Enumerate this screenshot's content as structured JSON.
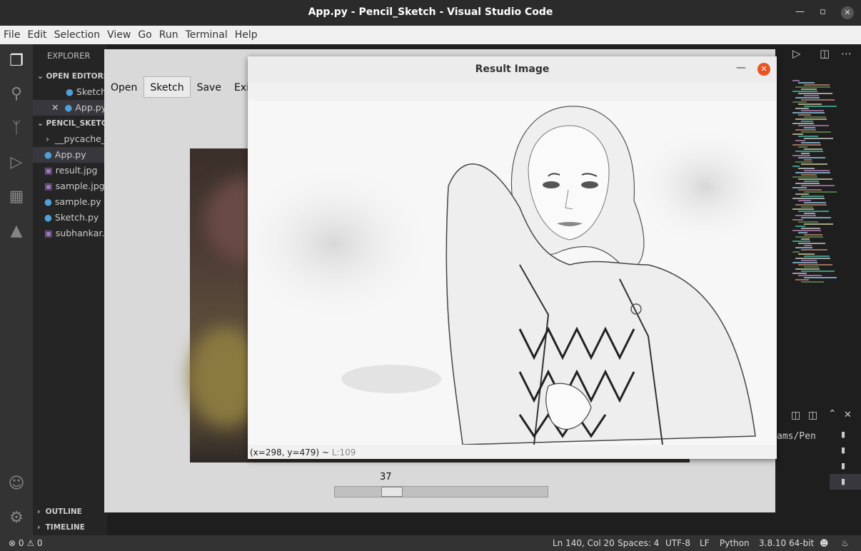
{
  "window": {
    "title": "App.py - Pencil_Sketch - Visual Studio Code"
  },
  "menubar": [
    "File",
    "Edit",
    "Selection",
    "View",
    "Go",
    "Run",
    "Terminal",
    "Help"
  ],
  "activity_icons": [
    "files-icon",
    "search-icon",
    "source-control-icon",
    "run-debug-icon",
    "extensions-icon",
    "testing-icon",
    "account-icon",
    "settings-gear-icon"
  ],
  "sidebar": {
    "header": "EXPLORER",
    "open_editors": "OPEN EDITORS",
    "open_files": [
      "Sketch.py",
      "App.py"
    ],
    "project": "PENCIL_SKETCH",
    "files": [
      "__pycache__",
      "App.py",
      "result.jpg",
      "sample.jpg",
      "sample.py",
      "Sketch.py",
      "subhankar.jpg"
    ],
    "outline": "OUTLINE",
    "timeline": "TIMELINE"
  },
  "terminal": {
    "text": "ams/Pen"
  },
  "app": {
    "buttons": [
      "Open",
      "Sketch",
      "Save",
      "Exit"
    ],
    "slider_value": "37",
    "slider_fraction": 0.24
  },
  "result_window": {
    "title": "Result Image",
    "coords": "(x=298, y=479) ~ ",
    "level": "L:109"
  },
  "status": {
    "problems": "⊗ 0 ⚠ 0",
    "position": "Ln 140, Col 20",
    "spaces": "Spaces: 4",
    "encoding": "UTF-8",
    "eol": "LF",
    "language": "Python",
    "interpreter": "3.8.10 64-bit"
  }
}
